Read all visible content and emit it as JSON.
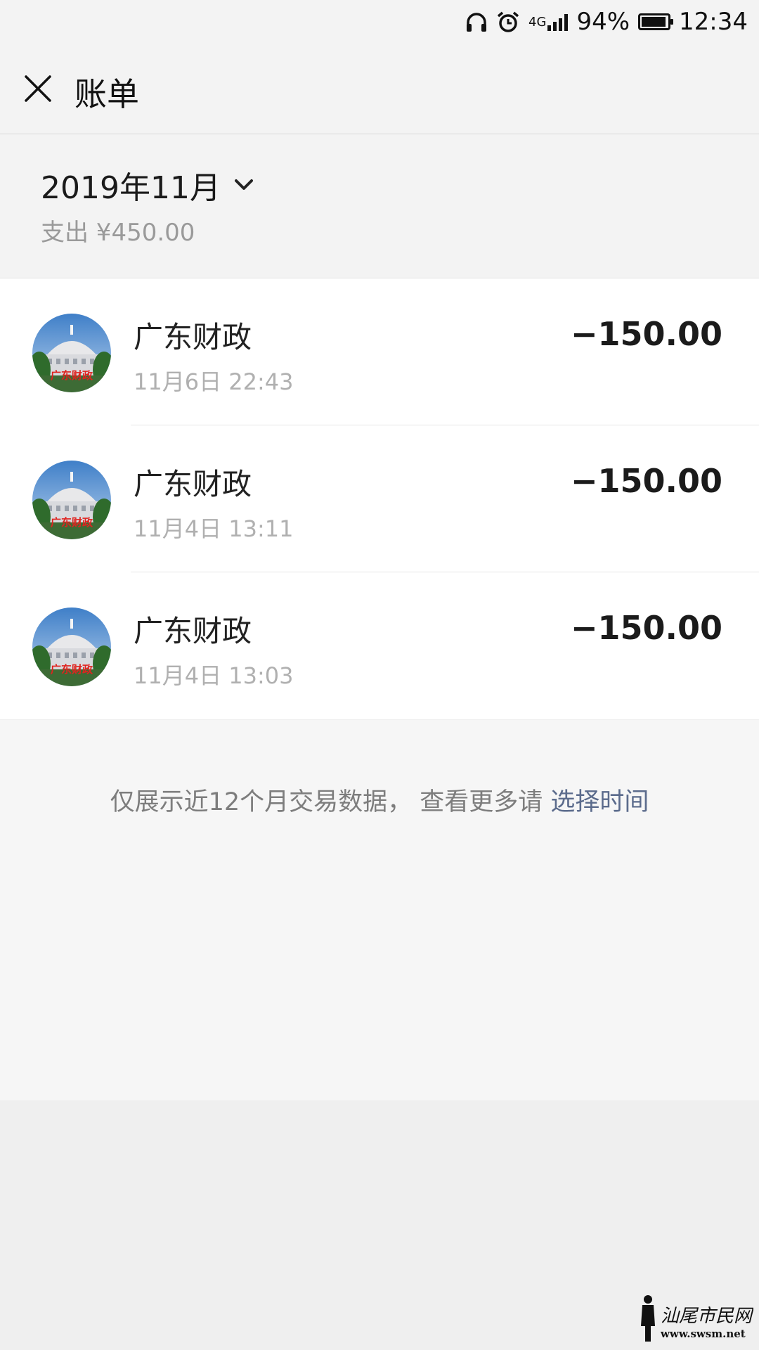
{
  "status_bar": {
    "network": "4G",
    "battery": "94%",
    "battery_level": 0.94,
    "time": "12:34",
    "icons": [
      "headphones-icon",
      "alarm-icon",
      "signal-icon",
      "battery-icon"
    ]
  },
  "header": {
    "close_icon": "close-icon",
    "title": "账单"
  },
  "summary": {
    "month": "2019年11月",
    "month_icon": "chevron-down-icon",
    "expense": "支出 ¥450.00"
  },
  "transactions": [
    {
      "name": "广东财政",
      "time": "11月6日 22:43",
      "amount": "−150.00",
      "avatar_text": "广东财政"
    },
    {
      "name": "广东财政",
      "time": "11月4日 13:11",
      "amount": "−150.00",
      "avatar_text": "广东财政"
    },
    {
      "name": "广东财政",
      "time": "11月4日 13:03",
      "amount": "−150.00",
      "avatar_text": "广东财政"
    }
  ],
  "footer": {
    "note": "仅展示近12个月交易数据， 查看更多请 ",
    "link": "选择时间"
  },
  "watermark": {
    "text": "汕尾市民网",
    "url": "www.swsm.net"
  },
  "colors": {
    "link": "#5b6b8c",
    "background": "#efefef",
    "card": "#ffffff"
  }
}
